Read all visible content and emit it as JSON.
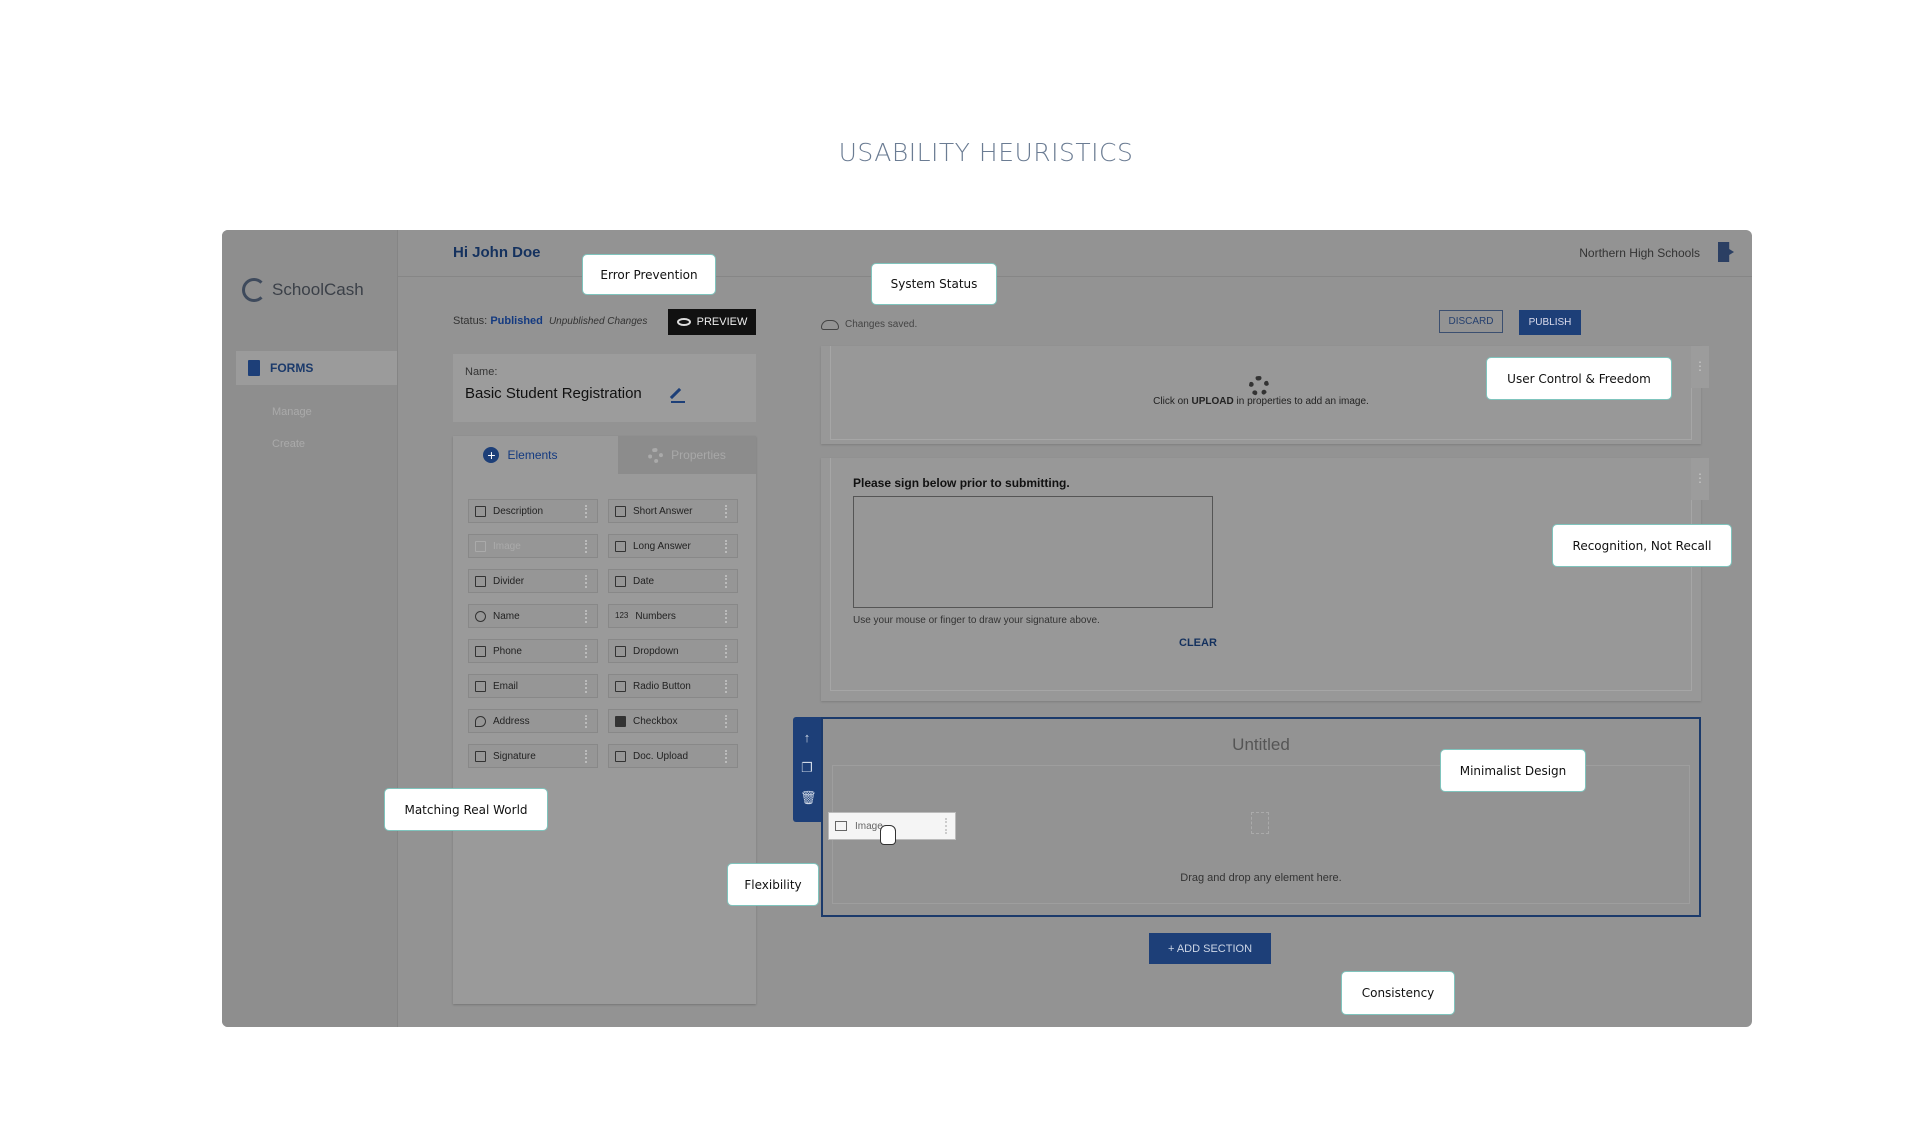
{
  "page_title": "USABILITY HEURISTICS",
  "app": {
    "logo_text": "SchoolCash",
    "nav": {
      "forms": "FORMS",
      "manage": "Manage",
      "create": "Create"
    },
    "header": {
      "greeting": "Hi John Doe",
      "organization": "Northern High Schools"
    },
    "status": {
      "label": "Status:",
      "value": "Published",
      "note": "Unpublished Changes",
      "saved": "Changes saved."
    },
    "buttons": {
      "preview": "PREVIEW",
      "discard": "DISCARD",
      "publish": "PUBLISH",
      "clear": "CLEAR",
      "add_section": "+ ADD SECTION"
    },
    "form_name": {
      "label": "Name:",
      "value": "Basic Student Registration"
    },
    "tabs": {
      "elements": "Elements",
      "properties": "Properties"
    },
    "elements_left": [
      "Description",
      "Image",
      "Divider",
      "Name",
      "Phone",
      "Email",
      "Address",
      "Signature"
    ],
    "elements_right": [
      "Short Answer",
      "Long Answer",
      "Date",
      "Numbers",
      "Dropdown",
      "Radio Button",
      "Checkbox",
      "Doc. Upload"
    ],
    "drag_ghost": "Image",
    "upload_card": {
      "prefix": "Click on ",
      "bold": "UPLOAD",
      "suffix": " in properties to add an image."
    },
    "signature_card": {
      "title": "Please sign below prior to submitting.",
      "help": "Use your mouse or finger to draw your signature above."
    },
    "section": {
      "title": "Untitled",
      "drop_text": "Drag and drop any element here."
    }
  },
  "callouts": {
    "error_prevention": "Error Prevention",
    "system_status": "System Status",
    "user_control": "User Control & Freedom",
    "recognition": "Recognition, Not Recall",
    "minimalist": "Minimalist Design",
    "matching": "Matching Real World",
    "flexibility": "Flexibility",
    "consistency": "Consistency"
  },
  "colors": {
    "brand": "#1d3f78",
    "callout_border": "#7fc4bd",
    "overlay": "#939393"
  }
}
